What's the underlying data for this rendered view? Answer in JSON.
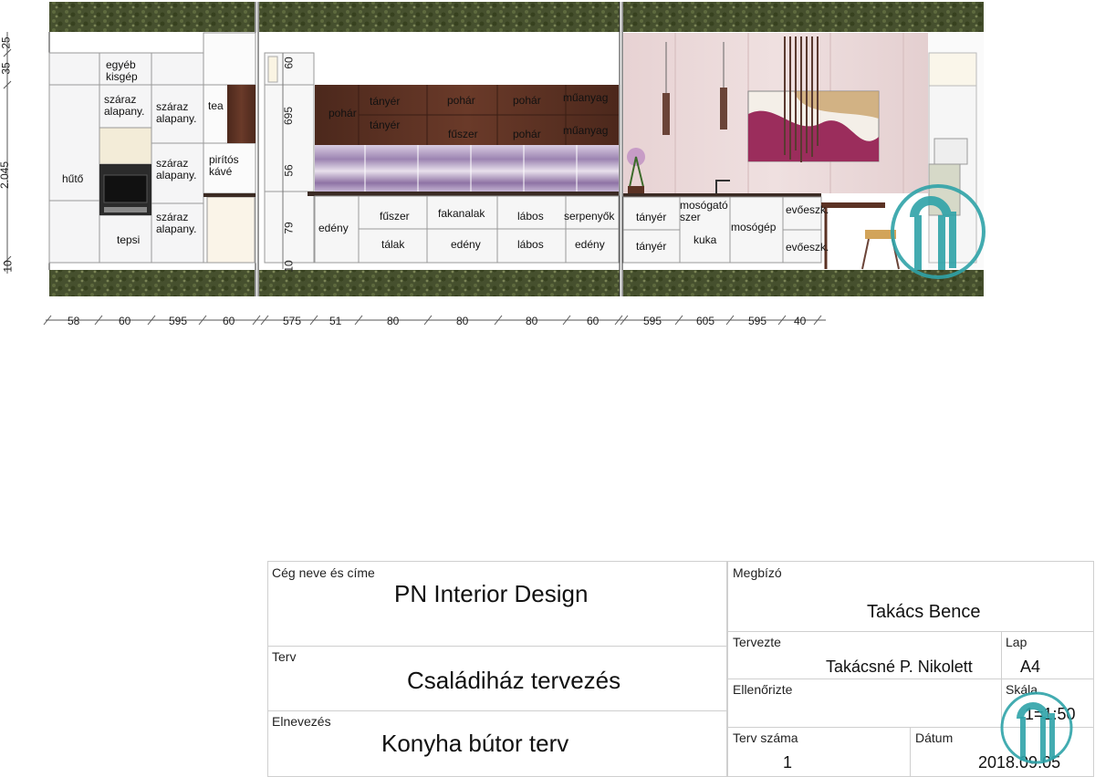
{
  "colors": {
    "countertop_texture": "#4a5530",
    "upper_cabinet_wood": "#5b3224",
    "backsplash_purple": "#b39ac4",
    "wall_pink": "#ead8d8",
    "logo_teal": "#2fa3a8",
    "cabinet_white": "#f4f4f4"
  },
  "vertical_dims": [
    "35",
    "25",
    "2.045",
    "10"
  ],
  "mid_dims": [
    "60",
    "695",
    "56",
    "79",
    "10"
  ],
  "bottom_dims": [
    "58",
    "60",
    "595",
    "60",
    "575",
    "51",
    "80",
    "80",
    "80",
    "60",
    "595",
    "605",
    "595",
    "40"
  ],
  "labels": {
    "s1": {
      "egyeb": "egyéb\nkisgép",
      "szaraz1": "száraz\nalapany.",
      "szaraz2": "száraz\nalapany.",
      "szaraz3": "száraz\nalapany.",
      "szaraz4": "száraz\nalapany.",
      "huto": "hűtő",
      "tea": "tea",
      "piritos": "pirítós\nkávé",
      "tepsi": "tepsi"
    },
    "s2": {
      "pohar1": "pohár",
      "tanyer1": "tányér",
      "tanyer2": "tányér",
      "pohar2": "pohár",
      "fuszer1": "fűszer",
      "pohar3": "pohár",
      "pohar4": "pohár",
      "muanyag1": "műanyag",
      "muanyag2": "műanyag",
      "edeny1": "edény",
      "fuszer2": "fűszer",
      "talak": "tálak",
      "fakanalak": "fakanalak",
      "edeny2": "edény",
      "labos1": "lábos",
      "labos2": "lábos",
      "serpenyok": "serpenyők",
      "edeny3": "edény"
    },
    "s3": {
      "tanyer3": "tányér",
      "tanyer4": "tányér",
      "mosogato": "mosógató\nszer",
      "kuka": "kuka",
      "mosogep": "mosógép",
      "evoeszk1": "evőeszk.",
      "evoeszk2": "evőeszk."
    }
  },
  "title_block": {
    "ceg_caption": "Cég neve és címe",
    "ceg_value": "PN Interior Design",
    "terv_caption": "Terv",
    "terv_value": "Családiház tervezés",
    "elnevezes_caption": "Elnevezés",
    "elnevezes_value": "Konyha bútor terv",
    "megbizo_caption": "Megbízó",
    "megbizo_value": "Takács Bence",
    "tervezte_caption": "Tervezte",
    "tervezte_value": "Takácsné P. Nikolett",
    "lap_caption": "Lap",
    "lap_value": "A4",
    "ellenorizte_caption": "Ellenőrizte",
    "skala_caption": "Skála",
    "skala_value": "1=1:50",
    "tervszama_caption": "Terv száma",
    "tervszama_value": "1",
    "datum_caption": "Dátum",
    "datum_value": "2018.09.05"
  }
}
